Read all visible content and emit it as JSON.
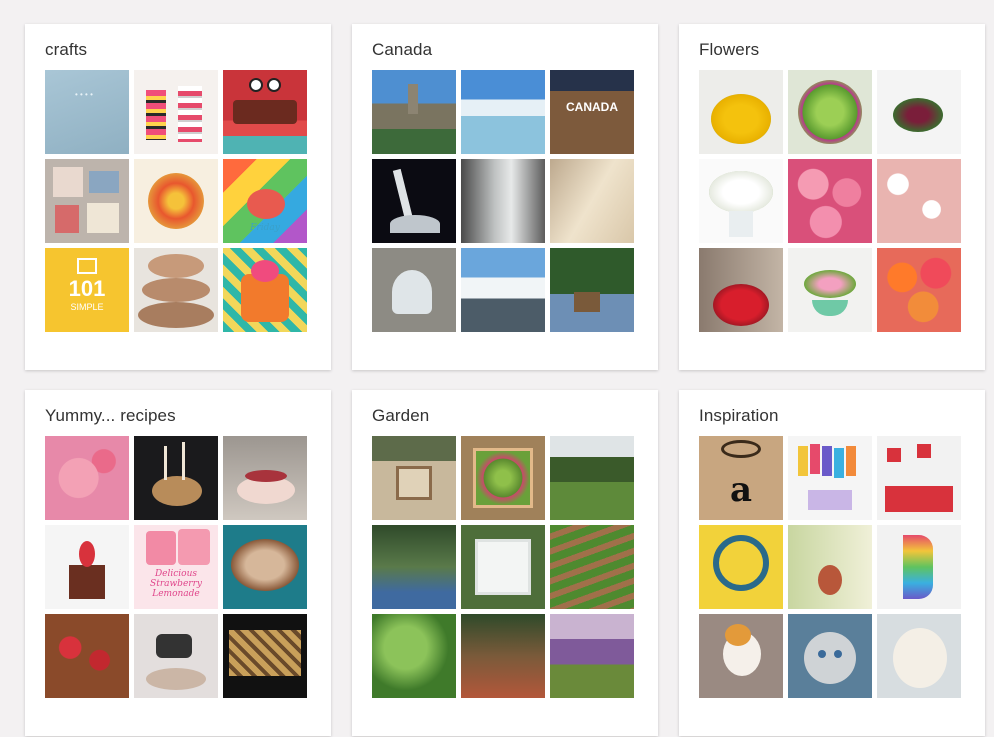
{
  "boards": [
    {
      "title": "crafts"
    },
    {
      "title": "Canada"
    },
    {
      "title": "Flowers"
    },
    {
      "title": "Yummy... recipes"
    },
    {
      "title": "Garden"
    },
    {
      "title": "Inspiration"
    }
  ],
  "thumb_text": {
    "crafts_big": "101",
    "crafts_sub": "SIMPLE",
    "canada_sign": "CANADA",
    "recipe_caption": "Delicious Strawberry Lemonade",
    "inspiration_letter": "a"
  }
}
